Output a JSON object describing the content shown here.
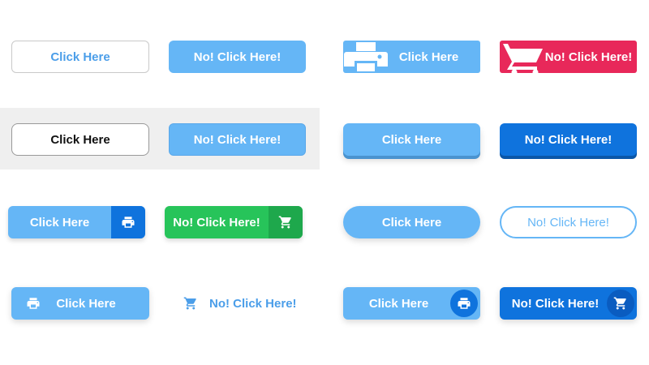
{
  "colors": {
    "light_blue": "#65b6f6",
    "dark_blue": "#0f73dd",
    "pink": "#e8285a",
    "green": "#27c45a",
    "gray_band": "#efefef"
  },
  "buttons": {
    "outline_blue": {
      "label": "Click Here"
    },
    "filled_light_r1": {
      "label": "No! Click Here!"
    },
    "print_big_icon": {
      "label": "Click Here",
      "icon": "printer-icon"
    },
    "cart_big_icon": {
      "label": "No! Click Here!",
      "icon": "cart-icon"
    },
    "outline_dark": {
      "label": "Click Here"
    },
    "filled_light_r2": {
      "label": "No! Click Here!"
    },
    "raised_light": {
      "label": "Click Here"
    },
    "raised_dark": {
      "label": "No! Click Here!"
    },
    "split_print": {
      "label": "Click Here",
      "icon": "printer-icon"
    },
    "split_cart_green": {
      "label": "No! Click Here!",
      "icon": "cart-icon"
    },
    "pill_filled": {
      "label": "Click Here"
    },
    "pill_outline": {
      "label": "No! Click Here!"
    },
    "print_left_icon": {
      "label": "Click Here",
      "icon": "printer-icon"
    },
    "cart_link": {
      "label": "No! Click Here!",
      "icon": "cart-icon"
    },
    "circle_print": {
      "label": "Click Here",
      "icon": "printer-icon"
    },
    "circle_cart": {
      "label": "No! Click Here!",
      "icon": "cart-icon"
    }
  }
}
